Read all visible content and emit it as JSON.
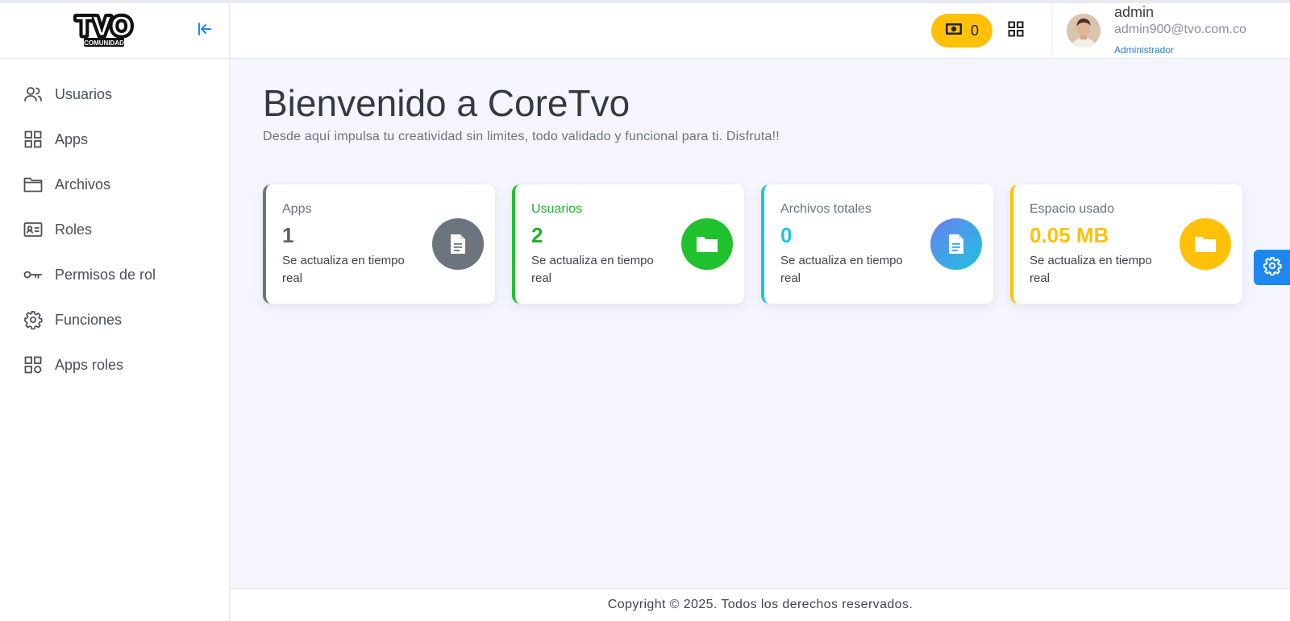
{
  "brand": {
    "logo_text": "TVO",
    "logo_subtext": "COMUNIDAD"
  },
  "sidebar": {
    "items": [
      {
        "label": "Usuarios",
        "icon": "users-icon"
      },
      {
        "label": "Apps",
        "icon": "grid-icon"
      },
      {
        "label": "Archivos",
        "icon": "folder-icon"
      },
      {
        "label": "Roles",
        "icon": "id-card-icon"
      },
      {
        "label": "Permisos de rol",
        "icon": "key-icon"
      },
      {
        "label": "Funciones",
        "icon": "gear-icon"
      },
      {
        "label": "Apps roles",
        "icon": "grid-icon"
      }
    ]
  },
  "header": {
    "coins": "0",
    "user": {
      "name": "admin",
      "email": "admin900@tvo.com.co",
      "role": "Administrador"
    }
  },
  "main": {
    "title": "Bienvenido a CoreTvo",
    "subtitle": "Desde aquí impulsa tu creatividad sin limites, todo validado y funcional para ti. Disfruta!!",
    "cards": [
      {
        "label": "Apps",
        "value": "1",
        "note": "Se actualiza en tiempo real",
        "accent": "#6c757d",
        "icon": "document-icon"
      },
      {
        "label": "Usuarios",
        "value": "2",
        "note": "Se actualiza en tiempo real",
        "accent": "#1fc12c",
        "icon": "folder-icon"
      },
      {
        "label": "Archivos totales",
        "value": "0",
        "note": "Se actualiza en tiempo real",
        "accent": "#1ec3e0",
        "icon": "document-icon"
      },
      {
        "label": "Espacio usado",
        "value": "0.05 MB",
        "note": "Se actualiza en tiempo real",
        "accent": "#ffc107",
        "icon": "folder-icon"
      }
    ]
  },
  "footer": {
    "copyright": "Copyright © 2025. Todos los derechos reservados."
  },
  "colors": {
    "primary": "#1e88f0",
    "coin_pill": "#ffc107"
  }
}
